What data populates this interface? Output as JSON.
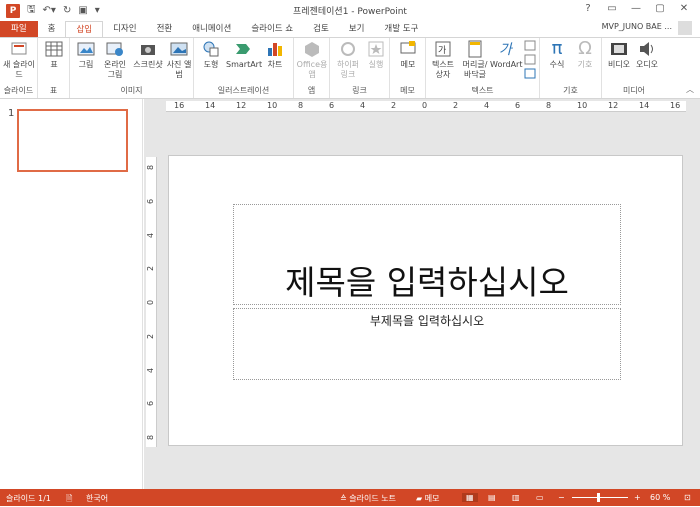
{
  "window": {
    "title": "프레젠테이션1 - PowerPoint",
    "app_icon": "P"
  },
  "qat": {
    "save_icon": "save-icon",
    "undo_icon": "undo-icon",
    "redo_icon": "redo-icon",
    "customize": "▾"
  },
  "window_controls": [
    "?",
    "▭",
    "—",
    "▢",
    "✕"
  ],
  "tabs": [
    {
      "label": "파일"
    },
    {
      "label": "홈"
    },
    {
      "label": "삽입"
    },
    {
      "label": "디자인"
    },
    {
      "label": "전환"
    },
    {
      "label": "애니메이션"
    },
    {
      "label": "슬라이드 쇼"
    },
    {
      "label": "검토"
    },
    {
      "label": "보기"
    },
    {
      "label": "개발 도구"
    }
  ],
  "user": {
    "name": "MVP_JUNO BAE ..."
  },
  "ribbon": {
    "groups": [
      {
        "label": "슬라이드",
        "buttons": [
          "새 슬라이드"
        ]
      },
      {
        "label": "표",
        "buttons": [
          "표"
        ]
      },
      {
        "label": "이미지",
        "buttons": [
          "그림",
          "온라인 그림",
          "스크린샷",
          "사진 앨범"
        ]
      },
      {
        "label": "일러스트레이션",
        "buttons": [
          "도형",
          "SmartArt",
          "차트"
        ]
      },
      {
        "label": "앱",
        "buttons": [
          "Office용 앱"
        ]
      },
      {
        "label": "링크",
        "buttons": [
          "하이퍼링크",
          "실행"
        ]
      },
      {
        "label": "메모",
        "buttons": [
          "메모"
        ]
      },
      {
        "label": "텍스트",
        "buttons": [
          "텍스트 상자",
          "머리글/ 바닥글",
          "WordArt"
        ]
      },
      {
        "label": "기호",
        "buttons": [
          "수식",
          "기호"
        ]
      },
      {
        "label": "미디어",
        "buttons": [
          "비디오",
          "오디오"
        ]
      }
    ]
  },
  "thumbnail": {
    "number": "1"
  },
  "slide": {
    "title_placeholder": "제목을 입력하십시오",
    "subtitle_placeholder": "부제목을 입력하십시오"
  },
  "ruler": {
    "h": [
      "16",
      "14",
      "12",
      "10",
      "8",
      "6",
      "4",
      "2",
      "0",
      "2",
      "4",
      "6",
      "8",
      "10",
      "12",
      "14",
      "16"
    ],
    "v": [
      "8",
      "6",
      "4",
      "2",
      "0",
      "2",
      "4",
      "6",
      "8"
    ]
  },
  "status": {
    "slide_pos": "슬라이드 1/1",
    "language": "한국어",
    "notes": "슬라이드 노트",
    "comments": "메모",
    "zoom": "60 %"
  },
  "colors": {
    "accent": "#d24726",
    "selection": "#e06b46"
  }
}
